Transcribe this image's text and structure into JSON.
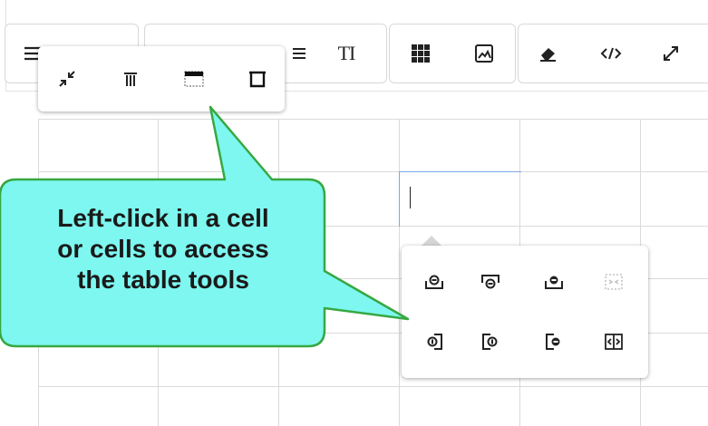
{
  "colors": {
    "callout_fill": "#7ef7f0",
    "callout_border": "#37a842",
    "active_cell_border": "#7aa7e6",
    "disabled_icon": "#c4c4c4"
  },
  "toolbar": {
    "groups": [
      {
        "buttons": [
          "align-justify-icon",
          "horizontal-rule-icon"
        ]
      },
      {
        "buttons": [
          "heading-bar-icon",
          "list-icon",
          "text-size-icon"
        ],
        "text_size_label": "TI"
      },
      {
        "buttons": [
          "table-grid-icon",
          "image-icon"
        ]
      },
      {
        "buttons": [
          "eraser-icon",
          "code-view-icon",
          "fullscreen-icon"
        ]
      }
    ]
  },
  "table_popup": {
    "buttons": [
      "table-shrink-icon",
      "table-column-style-icon",
      "table-header-row-icon",
      "table-delete-icon"
    ]
  },
  "cell_popup": {
    "row1": [
      "insert-row-above-icon",
      "insert-row-below-icon",
      "delete-row-icon",
      "merge-cells-icon"
    ],
    "row2": [
      "insert-column-left-icon",
      "insert-column-right-icon",
      "delete-column-icon",
      "split-cell-icon"
    ],
    "disabled": [
      "merge-cells-icon"
    ]
  },
  "callout": {
    "line1": "Left-click in a cell",
    "line2": "or cells to access",
    "line3": "the table tools"
  }
}
